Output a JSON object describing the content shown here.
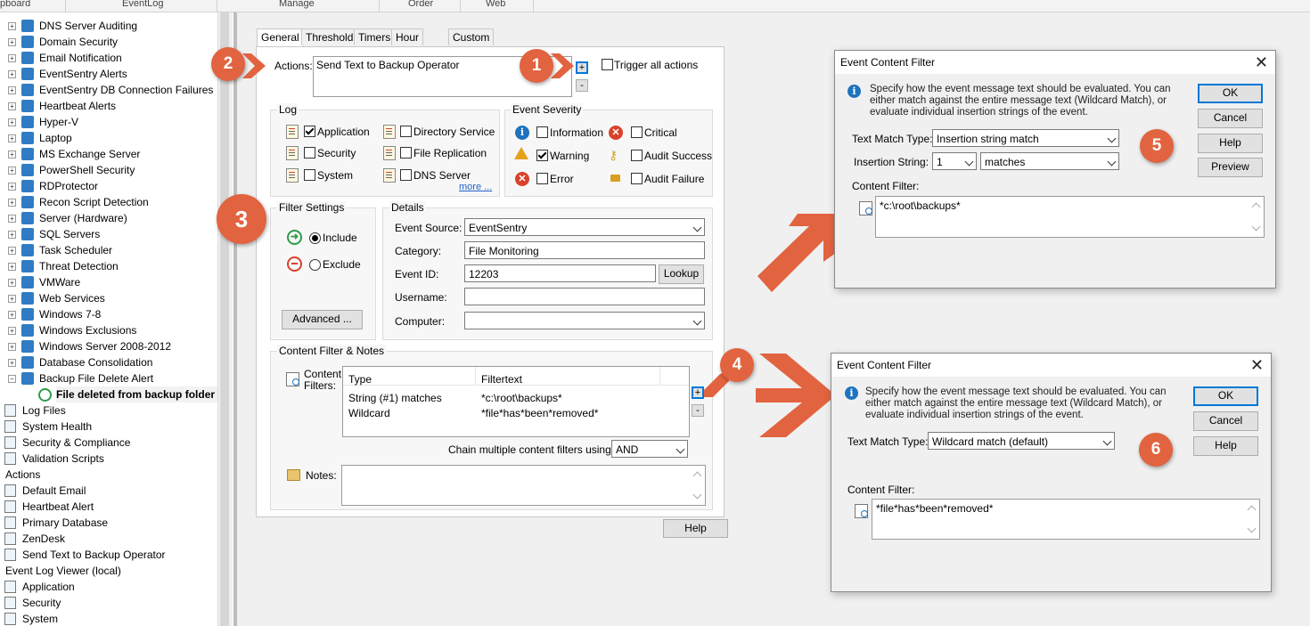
{
  "ribbon": {
    "tabs": [
      "pboard",
      "EventLog",
      "Manage",
      "Order",
      "Web"
    ]
  },
  "tree": {
    "items": [
      {
        "label": "DNS Server Auditing"
      },
      {
        "label": "Domain Security"
      },
      {
        "label": "Email Notification"
      },
      {
        "label": "EventSentry Alerts"
      },
      {
        "label": "EventSentry DB Connection Failures"
      },
      {
        "label": "Heartbeat Alerts"
      },
      {
        "label": "Hyper-V"
      },
      {
        "label": "Laptop"
      },
      {
        "label": "MS Exchange Server"
      },
      {
        "label": "PowerShell Security"
      },
      {
        "label": "RDProtector"
      },
      {
        "label": "Recon Script Detection"
      },
      {
        "label": "Server (Hardware)"
      },
      {
        "label": "SQL Servers"
      },
      {
        "label": "Task Scheduler"
      },
      {
        "label": "Threat Detection"
      },
      {
        "label": "VMWare"
      },
      {
        "label": "Web Services"
      },
      {
        "label": "Windows 7-8"
      },
      {
        "label": "Windows Exclusions"
      },
      {
        "label": "Windows Server 2008-2012"
      },
      {
        "label": "Database Consolidation"
      },
      {
        "label": "Backup File Delete Alert"
      },
      {
        "label": "File deleted from backup folder"
      },
      {
        "label": "Log Files"
      },
      {
        "label": "System Health"
      },
      {
        "label": "Security & Compliance"
      },
      {
        "label": "Validation Scripts"
      },
      {
        "label": "Actions"
      },
      {
        "label": "Default Email"
      },
      {
        "label": "Heartbeat Alert"
      },
      {
        "label": "Primary Database"
      },
      {
        "label": "ZenDesk"
      },
      {
        "label": "Send Text to Backup Operator"
      },
      {
        "label": "Event Log Viewer (local)"
      },
      {
        "label": "Application"
      },
      {
        "label": "Security"
      },
      {
        "label": "System"
      }
    ]
  },
  "tabs": [
    "General",
    "Threshold",
    "Timers",
    "Hour / Day",
    "Custom Event Logs"
  ],
  "actions": {
    "label": "Actions:",
    "value": "Send Text to Backup Operator",
    "trigger_all": "Trigger all actions",
    "add": "+",
    "remove": "-"
  },
  "log": {
    "title": "Log",
    "items": [
      {
        "label": "Application",
        "checked": true
      },
      {
        "label": "Security",
        "checked": false
      },
      {
        "label": "System",
        "checked": false
      },
      {
        "label": "Directory Service",
        "checked": false
      },
      {
        "label": "File Replication",
        "checked": false
      },
      {
        "label": "DNS Server",
        "checked": false
      }
    ],
    "more": "more ..."
  },
  "severity": {
    "title": "Event Severity",
    "items": [
      {
        "label": "Information",
        "checked": false,
        "icon": "information-icon"
      },
      {
        "label": "Warning",
        "checked": true,
        "icon": "warning-icon"
      },
      {
        "label": "Error",
        "checked": false,
        "icon": "error-icon"
      },
      {
        "label": "Critical",
        "checked": false,
        "icon": "critical-icon"
      },
      {
        "label": "Audit Success",
        "checked": false,
        "icon": "key-icon"
      },
      {
        "label": "Audit Failure",
        "checked": false,
        "icon": "lock-icon"
      }
    ]
  },
  "filter_settings": {
    "title": "Filter Settings",
    "include": "Include",
    "exclude": "Exclude",
    "selected": "Include",
    "advanced": "Advanced ..."
  },
  "details": {
    "title": "Details",
    "event_source_label": "Event Source:",
    "event_source": "EventSentry",
    "category_label": "Category:",
    "category": "File Monitoring",
    "event_id_label": "Event ID:",
    "event_id": "12203",
    "lookup": "Lookup",
    "username_label": "Username:",
    "username": "",
    "computer_label": "Computer:",
    "computer": ""
  },
  "content_filter": {
    "title": "Content Filter & Notes",
    "filters_label_1": "Content",
    "filters_label_2": "Filters:",
    "columns": [
      "Type",
      "Filtertext"
    ],
    "rows": [
      {
        "type": "String (#1) matches",
        "text": "*c:\\root\\backups*"
      },
      {
        "type": "Wildcard",
        "text": "*file*has*been*removed*"
      }
    ],
    "chain_label": "Chain multiple content filters using a",
    "chain_value": "AND",
    "notes_label": "Notes:",
    "notes": ""
  },
  "help": "Help",
  "callouts": [
    "1",
    "2",
    "3",
    "4",
    "5",
    "6"
  ],
  "dialog1": {
    "title": "Event Content Filter",
    "close": "✕",
    "description": "Specify how the event message text should be evaluated. You can either match against the entire message text (Wildcard Match), or evaluate individual insertion strings of the event.",
    "match_type_label": "Text Match Type:",
    "match_type": "Insertion string match",
    "insertion_label": "Insertion String:",
    "insertion_value": "1",
    "insertion_op": "matches",
    "content_filter_label": "Content Filter:",
    "content_filter": "*c:\\root\\backups*",
    "buttons": {
      "ok": "OK",
      "cancel": "Cancel",
      "help": "Help",
      "preview": "Preview"
    }
  },
  "dialog2": {
    "title": "Event Content Filter",
    "close": "✕",
    "description": "Specify how the event message text should be evaluated. You can either match against the entire message text (Wildcard Match), or evaluate individual insertion strings of the event.",
    "match_type_label": "Text Match Type:",
    "match_type": "Wildcard match (default)",
    "content_filter_label": "Content Filter:",
    "content_filter": "*file*has*been*removed*",
    "buttons": {
      "ok": "OK",
      "cancel": "Cancel",
      "help": "Help"
    }
  },
  "colors": {
    "accent": "#0078d7",
    "callout": "#e2633f",
    "panel": "#f0f0f0"
  }
}
